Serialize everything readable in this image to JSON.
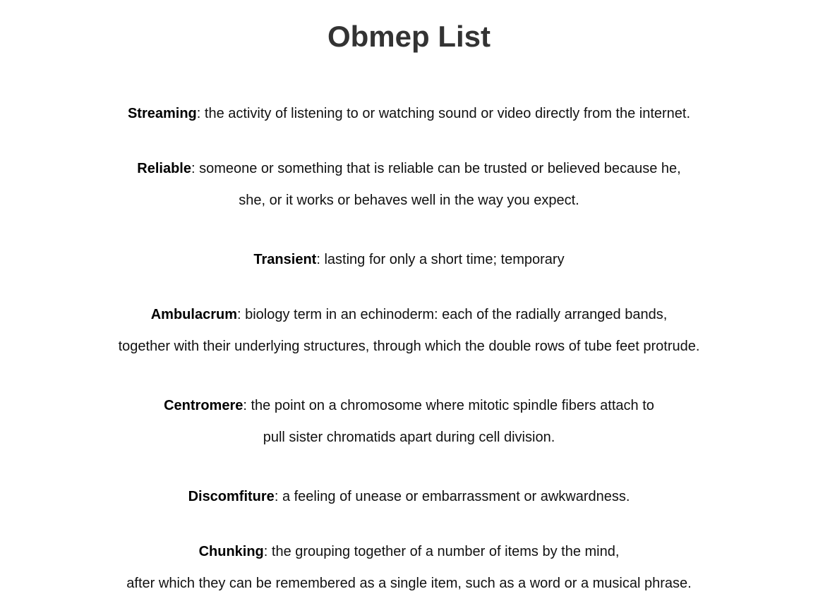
{
  "title": "Obmep List",
  "entries": [
    {
      "term": "Streaming",
      "sep": ": ",
      "lines": [
        "the activity of listening to or watching sound or video directly from the internet."
      ]
    },
    {
      "term": "Reliable",
      "sep": ": ",
      "lines": [
        "someone or something that is reliable can be trusted or believed because he,",
        "she, or it works or behaves well in the way you expect."
      ]
    },
    {
      "term": "Transient",
      "sep": ": ",
      "lines": [
        "lasting for only a short time; temporary"
      ]
    },
    {
      "term": "Ambulacrum",
      "sep": ": ",
      "lines": [
        "biology term in an echinoderm: each of the radially arranged bands,",
        "together with their underlying structures, through which the double rows of tube feet protrude."
      ]
    },
    {
      "term": "Centromere",
      "sep": ": ",
      "lines": [
        "the point on a chromosome where mitotic spindle fibers attach to",
        "pull sister chromatids apart during cell division."
      ]
    },
    {
      "term": "Discomfiture",
      "sep": ": ",
      "lines": [
        "a feeling of unease or embarrassment or awkwardness."
      ]
    },
    {
      "term": "Chunking",
      "sep": ": ",
      "lines": [
        "the grouping together of a number of items by the mind,",
        "after which they can be remembered as a single item, such as a word or a musical phrase."
      ]
    }
  ]
}
